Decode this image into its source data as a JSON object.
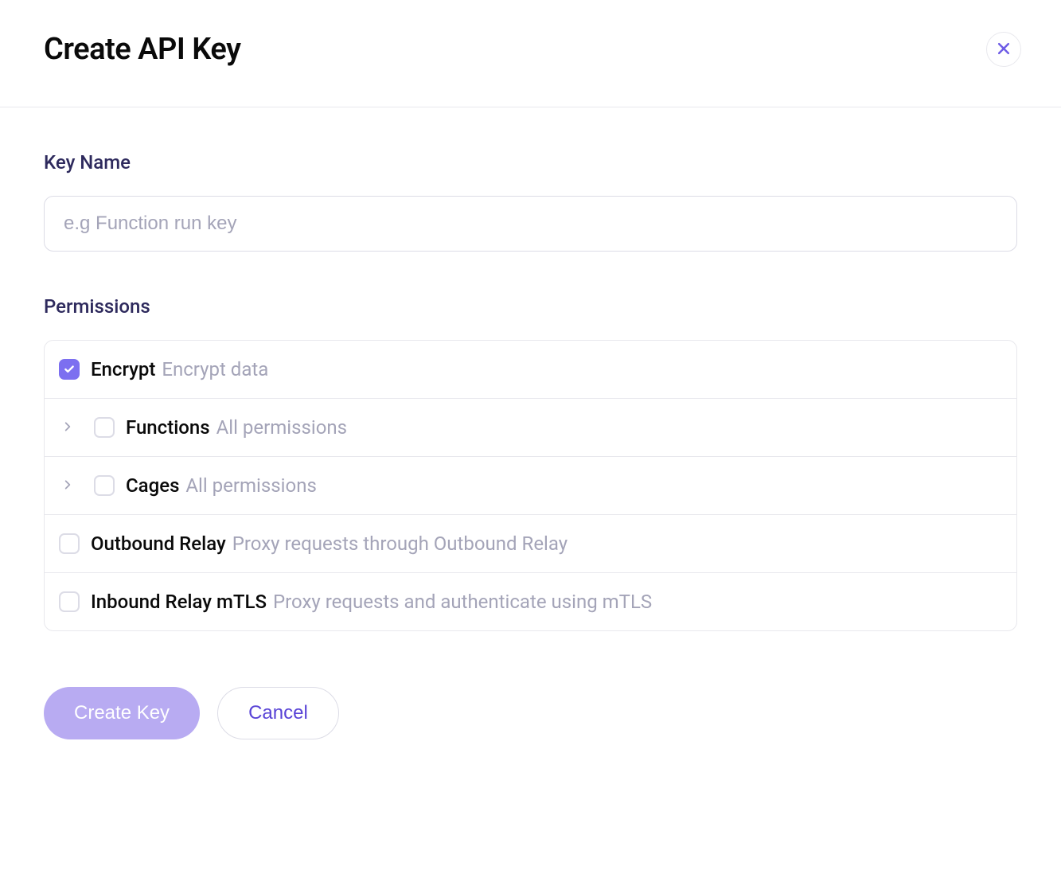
{
  "modal": {
    "title": "Create API Key"
  },
  "keyName": {
    "label": "Key Name",
    "placeholder": "e.g Function run key",
    "value": ""
  },
  "permissions": {
    "label": "Permissions",
    "items": [
      {
        "name": "Encrypt",
        "description": "Encrypt data",
        "checked": true,
        "expandable": false
      },
      {
        "name": "Functions",
        "description": "All permissions",
        "checked": false,
        "expandable": true
      },
      {
        "name": "Cages",
        "description": "All permissions",
        "checked": false,
        "expandable": true
      },
      {
        "name": "Outbound Relay",
        "description": "Proxy requests through Outbound Relay",
        "checked": false,
        "expandable": false
      },
      {
        "name": "Inbound Relay mTLS",
        "description": "Proxy requests and authenticate using mTLS",
        "checked": false,
        "expandable": false
      }
    ]
  },
  "footer": {
    "primary": "Create Key",
    "secondary": "Cancel"
  }
}
